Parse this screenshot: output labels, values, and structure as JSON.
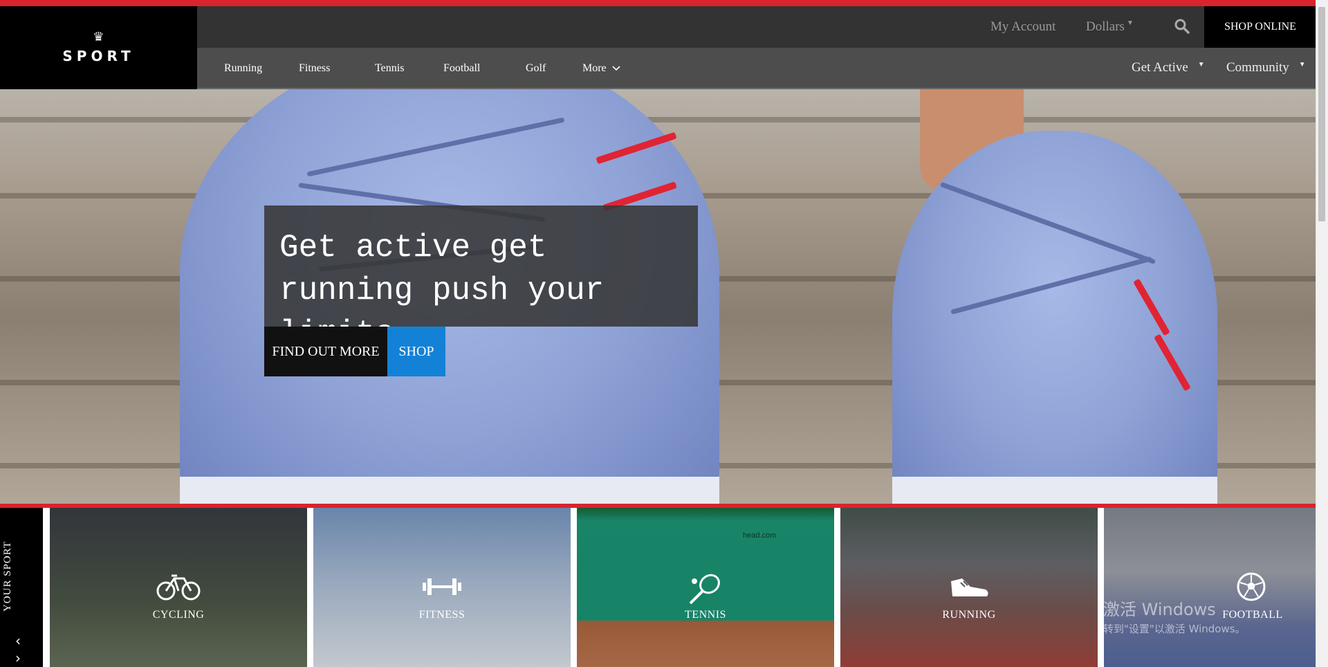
{
  "brand": {
    "name": "SPORT",
    "crown": "♛"
  },
  "topbar": {
    "my_account": "My Account",
    "currency": "Dollars",
    "shop_online": "SHOP ONLINE"
  },
  "nav": {
    "items": [
      "Running",
      "Fitness",
      "Tennis",
      "Football",
      "Golf"
    ],
    "more": "More",
    "right": [
      "Get Active",
      "Community"
    ]
  },
  "hero": {
    "headline": "Get active get running push your limits",
    "find_out_more": "FIND OUT MORE",
    "shop": "SHOP"
  },
  "sports_strip": {
    "title": "YOUR SPORT",
    "tiles": [
      {
        "label": "CYCLING",
        "icon": "bicycle-icon"
      },
      {
        "label": "FITNESS",
        "icon": "dumbbell-icon"
      },
      {
        "label": "TENNIS",
        "icon": "tennis-racket-icon"
      },
      {
        "label": "RUNNING",
        "icon": "running-shoe-icon"
      },
      {
        "label": "FOOTBALL",
        "icon": "soccer-ball-icon"
      }
    ],
    "tennis_banner_text": "head.com"
  },
  "watermark": {
    "line1": "激活 Windows",
    "line2": "转到\"设置\"以激活 Windows。"
  },
  "colors": {
    "accent_red": "#d9232d",
    "shop_blue": "#1382d6",
    "topbar": "#333333",
    "navbar": "#4d4d4d"
  }
}
